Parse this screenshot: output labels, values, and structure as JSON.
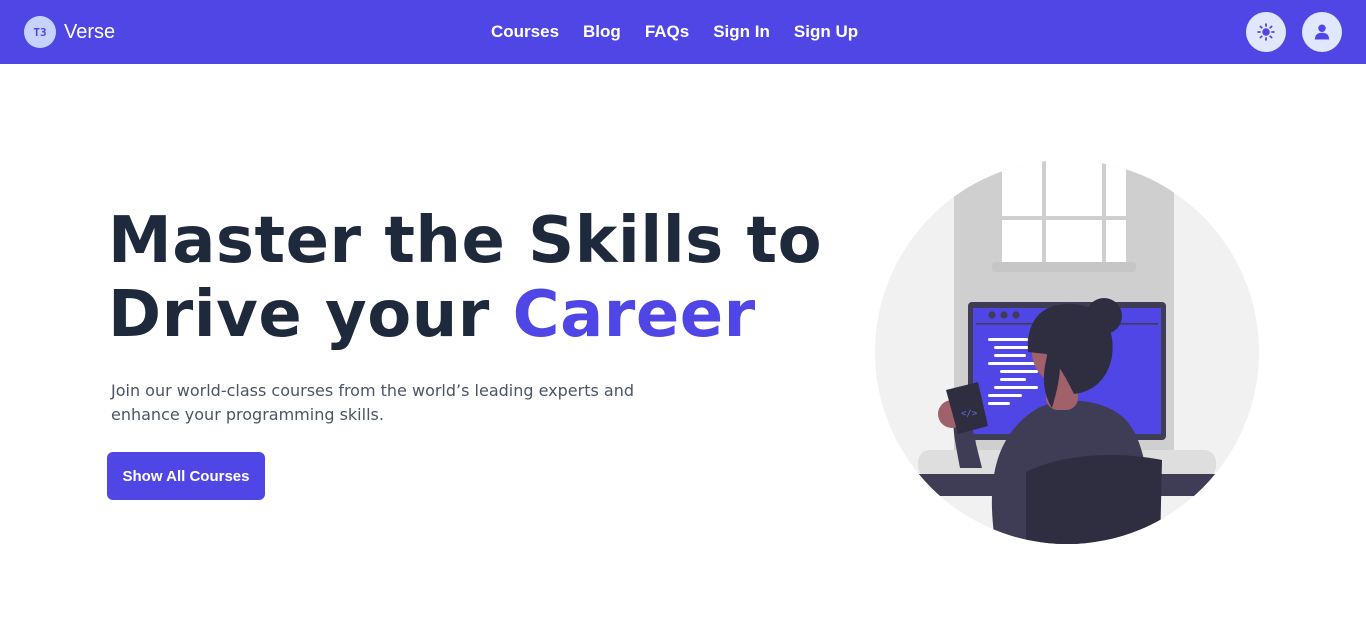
{
  "brand": {
    "logo_text": "T3",
    "name": "Verse"
  },
  "nav": {
    "links": [
      {
        "label": "Courses"
      },
      {
        "label": "Blog"
      },
      {
        "label": "FAQs"
      },
      {
        "label": "Sign In"
      },
      {
        "label": "Sign Up"
      }
    ],
    "theme_icon": "sun-icon",
    "user_icon": "user-icon"
  },
  "hero": {
    "title_line1": "Master the Skills to",
    "title_line2_prefix": "Drive your ",
    "title_line2_accent": "Career",
    "subtitle": "Join our world-class courses from the world’s leading experts and enhance your programming skills.",
    "cta_label": "Show All Courses",
    "illustration_icon": "developer-at-computer-illustration"
  },
  "colors": {
    "primary": "#4f46e5",
    "heading": "#1e293b",
    "body_text": "#4b5563",
    "icon_button_bg": "#e0e7ff"
  }
}
